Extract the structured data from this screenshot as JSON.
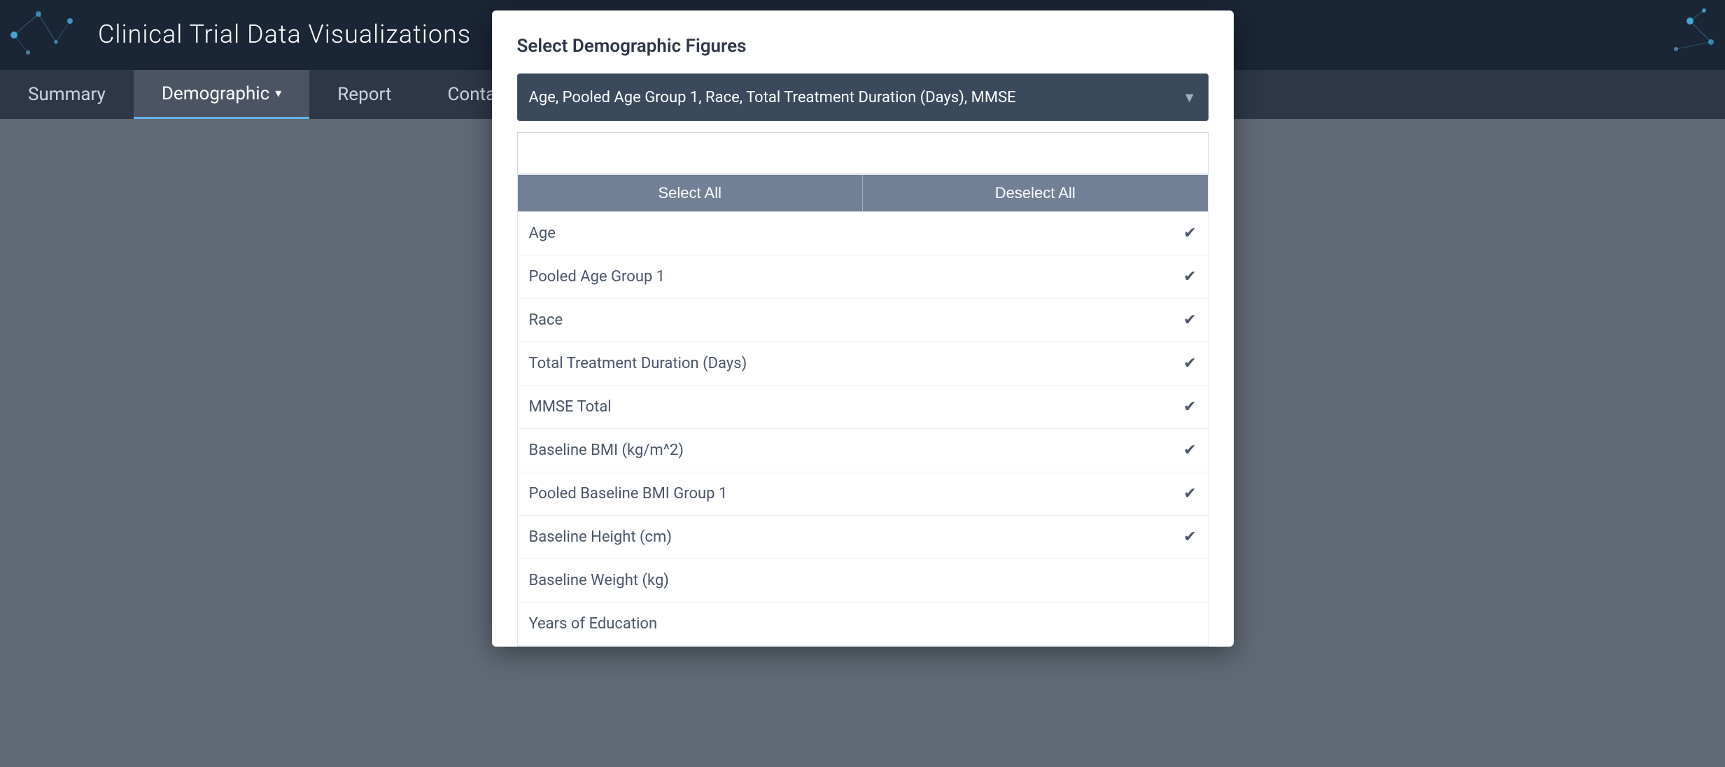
{
  "app": {
    "title": "Clinical Trial Data Visualizations"
  },
  "nav": {
    "items": [
      {
        "id": "summary",
        "label": "Summary",
        "active": false
      },
      {
        "id": "demographic",
        "label": "Demographic",
        "active": true,
        "hasDropdown": true
      },
      {
        "id": "report",
        "label": "Report",
        "active": false
      },
      {
        "id": "contact",
        "label": "Contact",
        "active": false
      }
    ]
  },
  "modal": {
    "title": "Select Demographic Figures",
    "select_label": "Age, Pooled Age Group 1, Race, Total Treatment Duration (Days), MMSE",
    "search_placeholder": "",
    "btn_select_all": "Select All",
    "btn_deselect_all": "Deselect All",
    "options": [
      {
        "id": "age",
        "label": "Age",
        "checked": true
      },
      {
        "id": "pooled-age-group-1",
        "label": "Pooled Age Group 1",
        "checked": true
      },
      {
        "id": "race",
        "label": "Race",
        "checked": true
      },
      {
        "id": "total-treatment-duration",
        "label": "Total Treatment Duration (Days)",
        "checked": true
      },
      {
        "id": "mmse-total",
        "label": "MMSE Total",
        "checked": true
      },
      {
        "id": "baseline-bmi",
        "label": "Baseline BMI (kg/m^2)",
        "checked": true
      },
      {
        "id": "pooled-baseline-bmi-group-1",
        "label": "Pooled Baseline BMI Group 1",
        "checked": true
      },
      {
        "id": "baseline-height",
        "label": "Baseline Height (cm)",
        "checked": true
      },
      {
        "id": "baseline-weight",
        "label": "Baseline Weight (kg)",
        "checked": false
      },
      {
        "id": "years-of-education",
        "label": "Years of Education",
        "checked": false
      }
    ]
  },
  "icons": {
    "check": "✔",
    "dropdown_arrow": "▼"
  }
}
